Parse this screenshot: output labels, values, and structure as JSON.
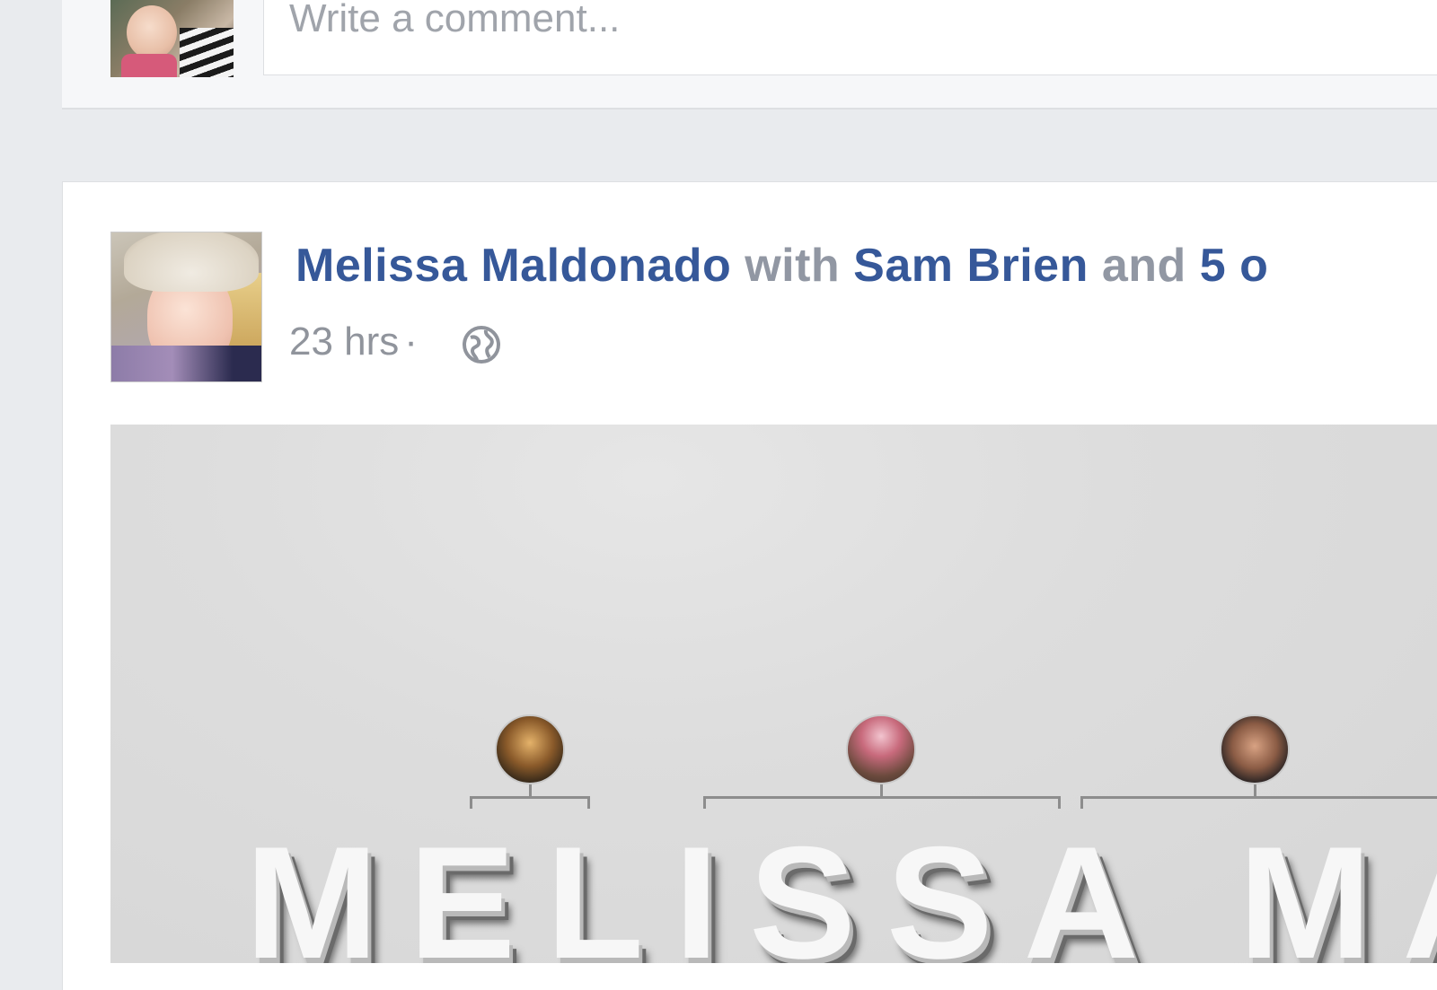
{
  "comment_composer": {
    "placeholder": "Write a comment..."
  },
  "post": {
    "author": "Melissa Maldonado",
    "with_word": "with",
    "tagged_friend": "Sam Brien",
    "and_word": "and",
    "others_label": "5 o",
    "time": "23 hrs",
    "separator": "·",
    "audience_icon": "globe-icon",
    "image_text": "MELISSA MALDO"
  },
  "colors": {
    "link": "#365899",
    "muted": "#90949c",
    "page_bg": "#e9ebee"
  }
}
